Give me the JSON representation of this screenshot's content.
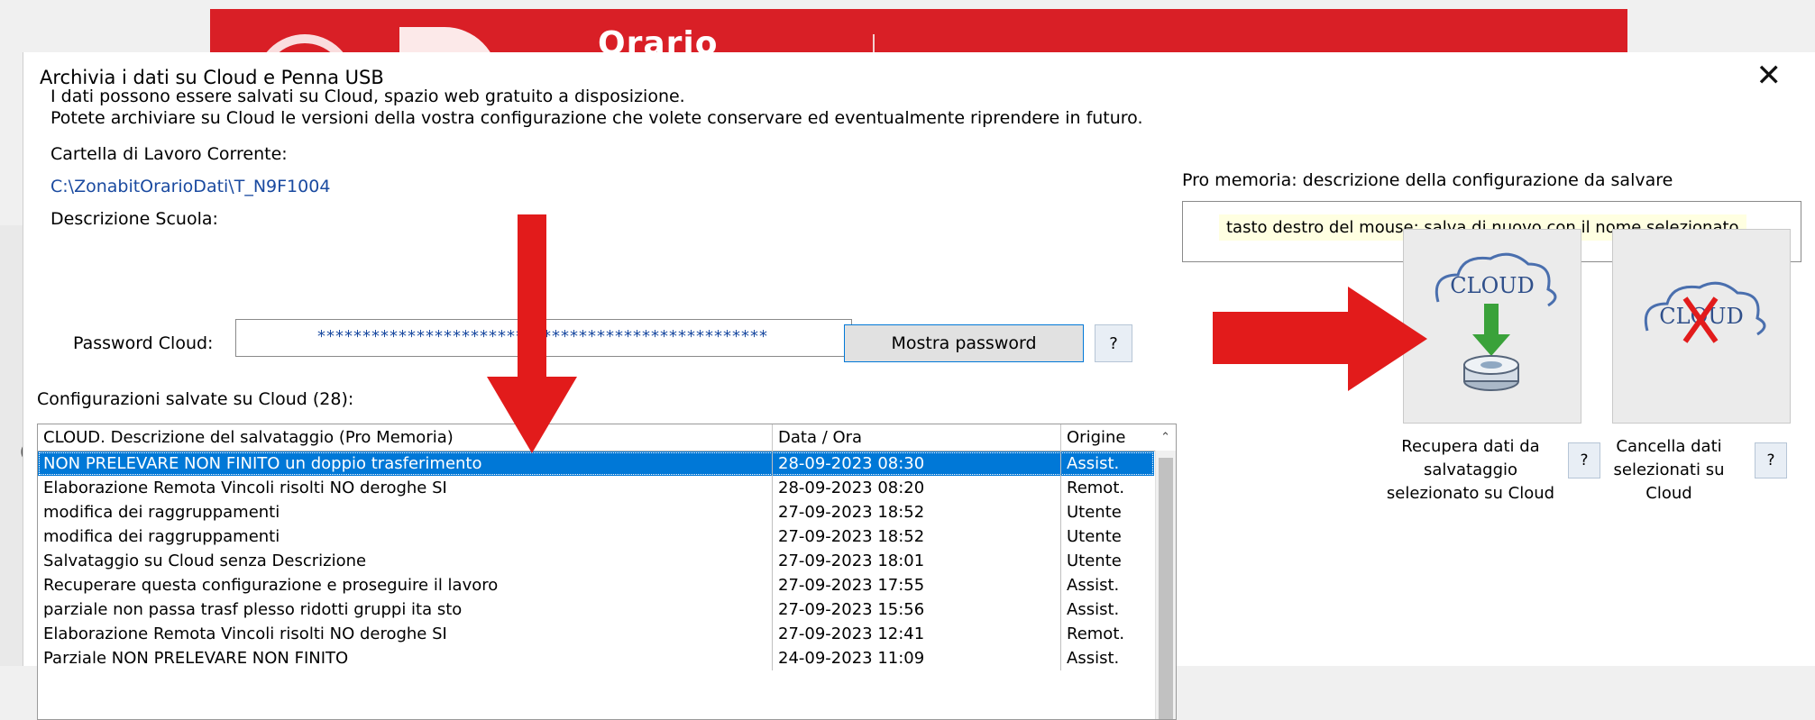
{
  "background": {
    "banner_brand": "Orario",
    "banner_color": "#d91f26"
  },
  "dialog": {
    "title": "Archivia i dati su Cloud e Penna USB",
    "close_glyph": "✕",
    "info_line1": "I dati possono essere salvati su Cloud, spazio web gratuito a disposizione.",
    "info_line2": "Potete archiviare su Cloud le versioni della vostra configurazione che volete conservare ed eventualmente riprendere in futuro.",
    "working_folder_label": "Cartella di Lavoro Corrente:",
    "working_folder_path": "C:\\ZonabitOrarioDati\\T_N9F1004",
    "school_description_label": "Descrizione Scuola:",
    "password_label": "Password Cloud:",
    "password_value": "**************************************************",
    "show_password_button": "Mostra password",
    "help_glyph": "?",
    "configs_label": "Configurazioni salvate su Cloud (28):",
    "memo_label": "Pro memoria: descrizione della configurazione da salvare",
    "memo_hint": "tasto destro del mouse: salva di nuovo con il nome selezionato",
    "recover_caption": "Recupera dati da salvataggio selezionato su Cloud",
    "delete_caption": "Cancella dati selezionati su Cloud",
    "cloud_icon_text": "CLOUD",
    "accent_color": "#0078d7",
    "arrow_color": "#e21b1b"
  },
  "table": {
    "columns": [
      "CLOUD. Descrizione del salvataggio (Pro Memoria)",
      "Data / Ora",
      "Origine"
    ],
    "rows": [
      [
        "NON PRELEVARE NON FINITO un doppio trasferimento",
        "28-09-2023 08:30",
        "Assist."
      ],
      [
        "Elaborazione Remota Vincoli risolti NO  deroghe SI",
        "28-09-2023 08:20",
        "Remot."
      ],
      [
        "modifica dei raggruppamenti",
        "27-09-2023 18:52",
        "Utente"
      ],
      [
        "modifica dei raggruppamenti",
        "27-09-2023 18:52",
        "Utente"
      ],
      [
        "Salvataggio su Cloud senza Descrizione",
        "27-09-2023 18:01",
        "Utente"
      ],
      [
        "Recuperare questa configurazione e proseguire il lavoro",
        "27-09-2023 17:55",
        "Assist."
      ],
      [
        "parziale non passa trasf plesso ridotti gruppi ita sto",
        "27-09-2023 15:56",
        "Assist."
      ],
      [
        "Elaborazione Remota Vincoli risolti NO  deroghe SI",
        "27-09-2023 12:41",
        "Remot."
      ],
      [
        "Parziale  NON PRELEVARE NON FINITO",
        "24-09-2023 11:09",
        "Assist."
      ]
    ],
    "selected_index": 0
  }
}
